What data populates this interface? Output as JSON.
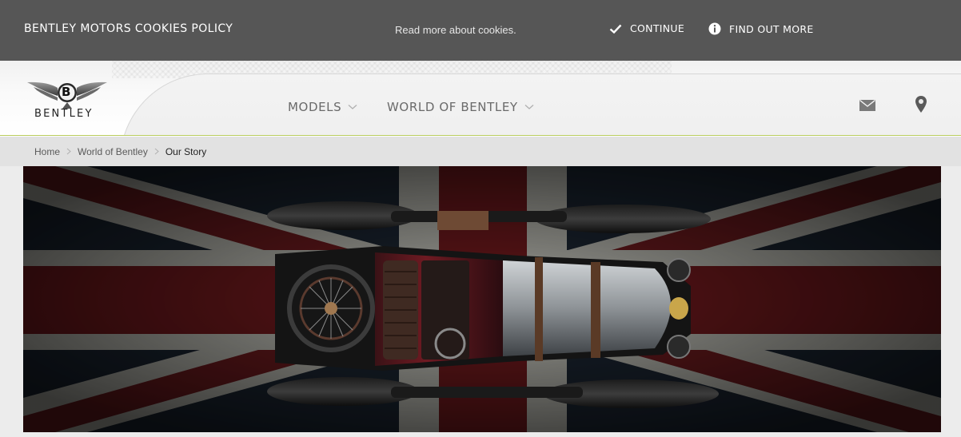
{
  "cookie_bar": {
    "title": "BENTLEY MOTORS COOKIES POLICY",
    "read_more": "Read more about cookies.",
    "continue_label": "CONTINUE",
    "find_out_more_label": "FIND OUT MORE",
    "background": "#565656"
  },
  "header": {
    "logo_text": "BENTLEY",
    "logo_emblem_letter": "B",
    "nav": [
      {
        "label": "MODELS",
        "icon": "chevron-down-icon"
      },
      {
        "label": "WORLD OF BENTLEY",
        "icon": "chevron-down-icon"
      }
    ],
    "icons": [
      "mail-icon",
      "location-pin-icon"
    ],
    "accent": "#b9cc5d"
  },
  "breadcrumb": {
    "items": [
      "Home",
      "World of Bentley",
      "Our Story"
    ]
  },
  "hero": {
    "image": "vintage-bentley-top-view-on-union-jack"
  }
}
